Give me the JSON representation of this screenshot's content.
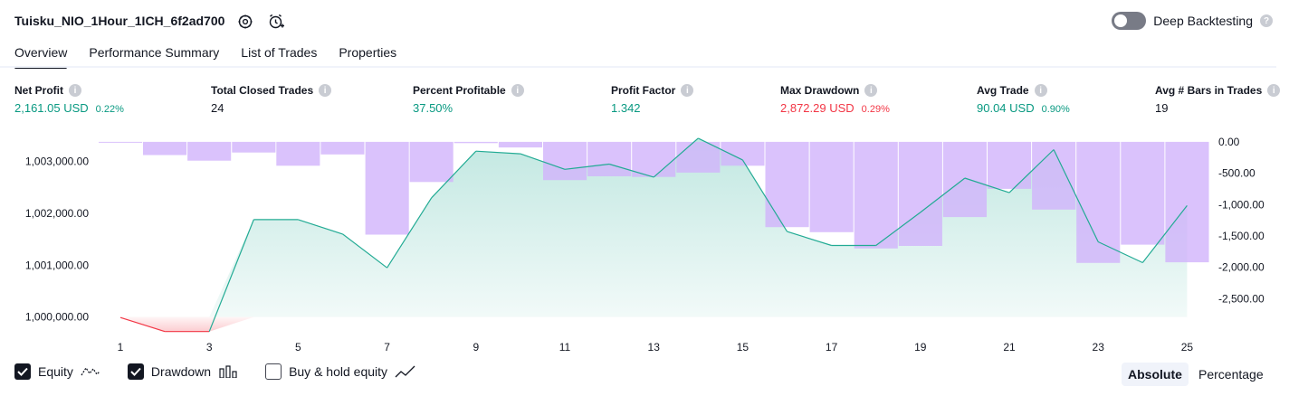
{
  "header": {
    "title": "Tuisku_NIO_1Hour_1ICH_6f2ad700",
    "settings_icon": "gear-icon",
    "alert_icon": "add-alert-clock-icon",
    "deep_backtesting_label": "Deep Backtesting",
    "deep_backtesting_on": false
  },
  "tabs": [
    {
      "label": "Overview",
      "active": true
    },
    {
      "label": "Performance Summary",
      "active": false
    },
    {
      "label": "List of Trades",
      "active": false
    },
    {
      "label": "Properties",
      "active": false
    }
  ],
  "stats": [
    {
      "label": "Net Profit",
      "value": "2,161.05 USD",
      "pct": "0.22%",
      "color": "green"
    },
    {
      "label": "Total Closed Trades",
      "value": "24",
      "pct": "",
      "color": "dark"
    },
    {
      "label": "Percent Profitable",
      "value": "37.50%",
      "pct": "",
      "color": "green"
    },
    {
      "label": "Profit Factor",
      "value": "1.342",
      "pct": "",
      "color": "green"
    },
    {
      "label": "Max Drawdown",
      "value": "2,872.29 USD",
      "pct": "0.29%",
      "color": "red"
    },
    {
      "label": "Avg Trade",
      "value": "90.04 USD",
      "pct": "0.90%",
      "color": "green"
    },
    {
      "label": "Avg # Bars in Trades",
      "value": "19",
      "pct": "",
      "color": "dark"
    }
  ],
  "legend": {
    "equity": {
      "label": "Equity",
      "checked": true
    },
    "drawdown": {
      "label": "Drawdown",
      "checked": true
    },
    "buy_hold": {
      "label": "Buy & hold equity",
      "checked": false
    }
  },
  "mode": {
    "absolute": "Absolute",
    "percentage": "Percentage",
    "active": "absolute"
  },
  "colors": {
    "equity_line": "#22ab94",
    "equity_negative": "#f23645",
    "drawdown_bar": "#d1b3fb",
    "green": "#089981",
    "red": "#f23645"
  },
  "chart_data": {
    "type": "area",
    "title": "",
    "baseline": 1000000,
    "x": [
      1,
      2,
      3,
      4,
      5,
      6,
      7,
      8,
      9,
      10,
      11,
      12,
      13,
      14,
      15,
      16,
      17,
      18,
      19,
      20,
      21,
      22,
      23,
      24,
      25
    ],
    "x_ticks": [
      1,
      3,
      5,
      7,
      9,
      11,
      13,
      15,
      17,
      19,
      21,
      23,
      25
    ],
    "left_ticks": [
      "1,003,000.00",
      "1,002,000.00",
      "1,001,000.00",
      "1,000,000.00"
    ],
    "left_tick_values": [
      1003000,
      1002000,
      1001000,
      1000000
    ],
    "right_ticks": [
      "0.00",
      "-500.00",
      "-1,000.00",
      "-1,500.00",
      "-2,000.00",
      "-2,500.00"
    ],
    "right_tick_values": [
      0,
      -500,
      -1000,
      -1500,
      -2000,
      -2500
    ],
    "series": [
      {
        "name": "Equity",
        "axis": "left",
        "ylim": [
          999750,
          1003500
        ],
        "values": [
          999990,
          999720,
          999720,
          1001880,
          1001880,
          1001600,
          1000950,
          1002300,
          1003200,
          1003150,
          1002850,
          1002950,
          1002700,
          1003450,
          1003030,
          1001650,
          1001380,
          1001380,
          1002020,
          1002680,
          1002400,
          1003230,
          1001450,
          1001050,
          1002150
        ]
      },
      {
        "name": "Drawdown",
        "axis": "right",
        "ylim": [
          -3000,
          100
        ],
        "values": [
          -10,
          -210,
          -300,
          -170,
          -380,
          -200,
          -1480,
          -640,
          -20,
          -90,
          -610,
          -550,
          -560,
          -490,
          -380,
          -1360,
          -1440,
          -1700,
          -1660,
          -1200,
          -750,
          -1080,
          -1930,
          -1640,
          -1920
        ]
      }
    ]
  }
}
